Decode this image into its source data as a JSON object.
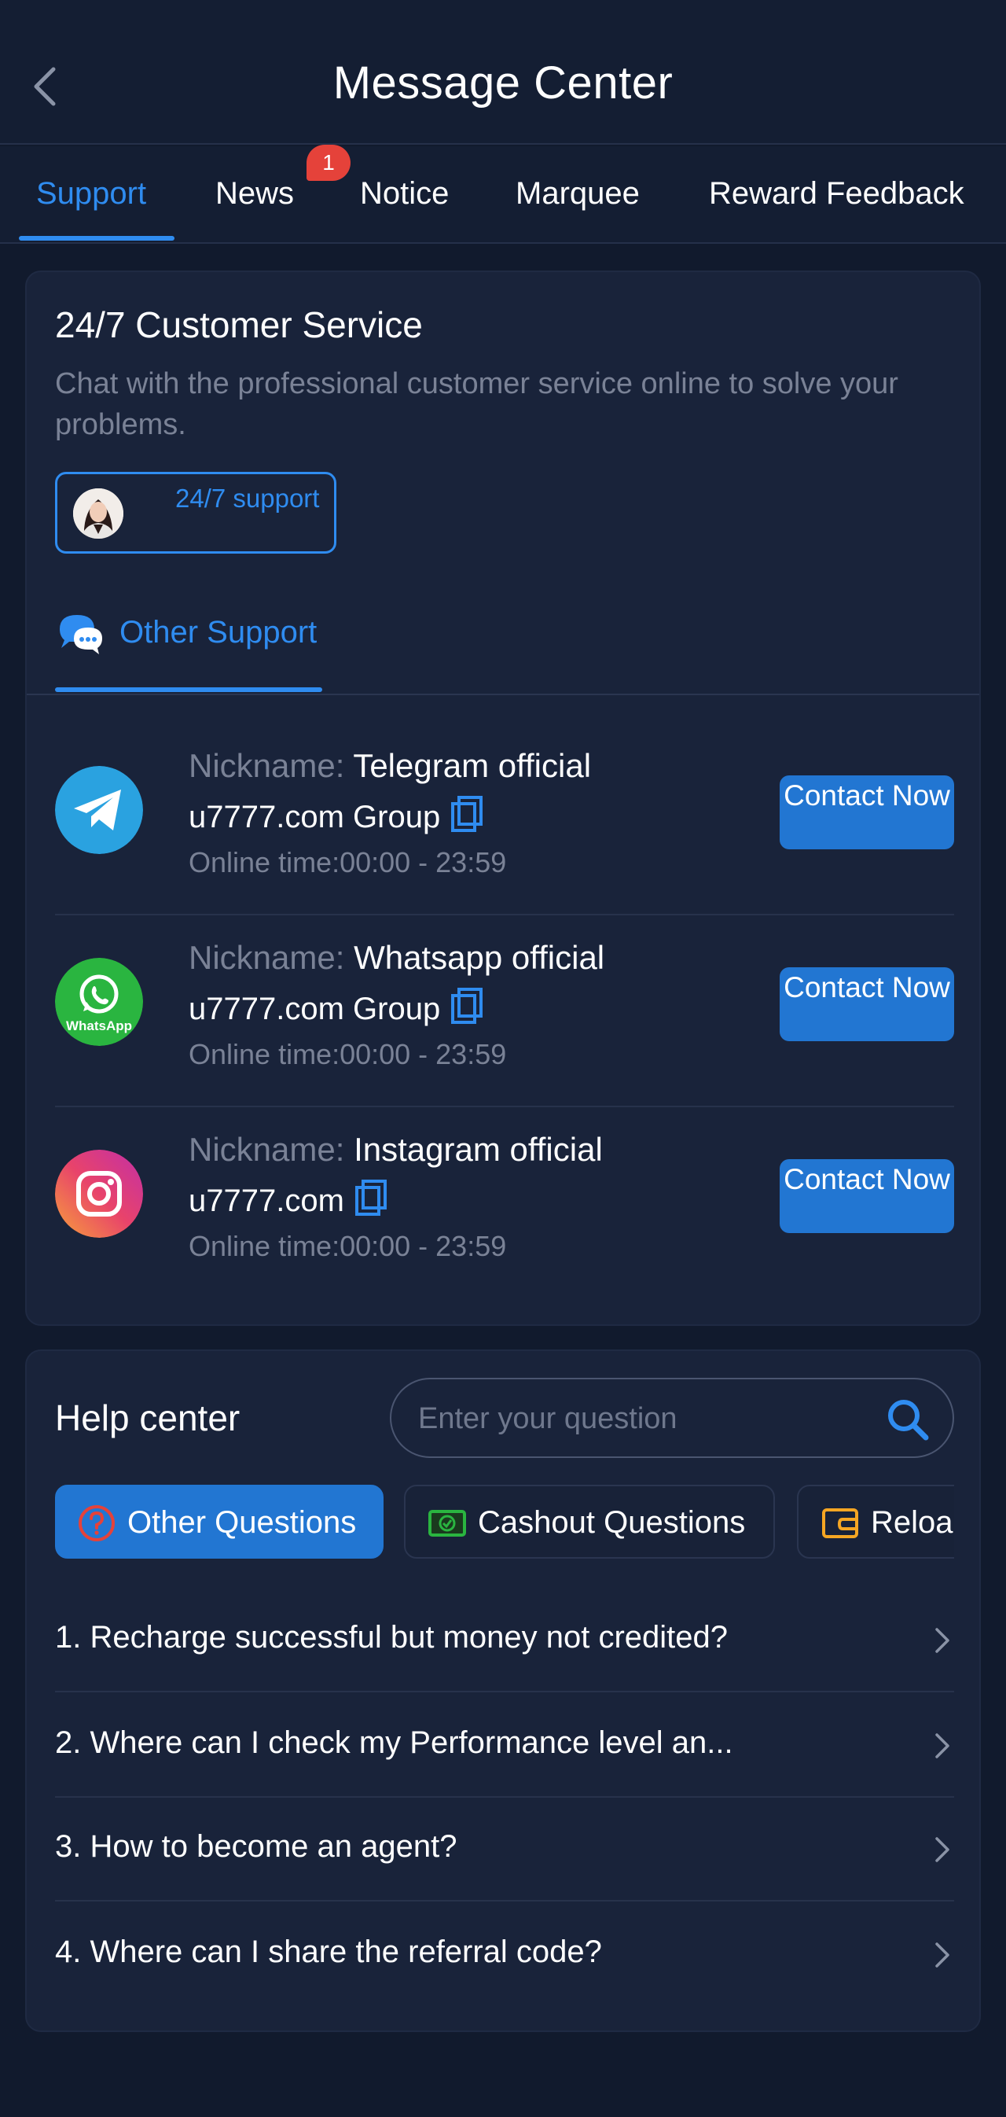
{
  "header": {
    "title": "Message Center",
    "back_icon": "chevron-left-icon"
  },
  "tabs": [
    {
      "label": "Support",
      "active": true
    },
    {
      "label": "News",
      "badge": "1"
    },
    {
      "label": "Notice"
    },
    {
      "label": "Marquee"
    },
    {
      "label": "Reward Feedback"
    }
  ],
  "customer_service": {
    "title": "24/7 Customer Service",
    "description": "Chat with the professional customer service online to solve your problems.",
    "support_button": {
      "label": "24/7 support",
      "icon": "agent-avatar"
    },
    "other_support_label": "Other Support",
    "other_support_icon": "chat-bubbles-icon"
  },
  "contacts": [
    {
      "nickname_key": "Nickname:",
      "nickname": "Telegram official",
      "account": "u7777.com Group",
      "online_time": "Online time:00:00 - 23:59",
      "button": "Contact Now",
      "icon": "telegram-icon",
      "color": "#2aa2e0"
    },
    {
      "nickname_key": "Nickname:",
      "nickname": "Whatsapp official",
      "account": "u7777.com Group",
      "online_time": "Online time:00:00 - 23:59",
      "button": "Contact Now",
      "icon": "whatsapp-icon",
      "logo_text": "WhatsApp",
      "color": "#2ab540"
    },
    {
      "nickname_key": "Nickname:",
      "nickname": "Instagram official",
      "account": "u7777.com",
      "online_time": "Online time:00:00 - 23:59",
      "button": "Contact Now",
      "icon": "instagram-icon",
      "color": "#e1306c"
    }
  ],
  "help_center": {
    "title": "Help center",
    "search_placeholder": "Enter your question",
    "categories": [
      {
        "label": "Other Questions",
        "icon": "question-circle-icon",
        "active": true
      },
      {
        "label": "Cashout Questions",
        "icon": "cash-icon"
      },
      {
        "label": "Reload",
        "icon": "wallet-icon"
      }
    ],
    "questions": [
      "1. Recharge successful but money not credited?",
      "2. Where can I check my Performance level an...",
      "3. How to become an agent?",
      "4. Where can I share the referral code?"
    ]
  },
  "colors": {
    "background": "#111a2d",
    "card": "#19233a",
    "accent": "#2f8cf0",
    "button": "#2276d2",
    "badge": "#e5423a",
    "muted_text": "#7a8296"
  }
}
